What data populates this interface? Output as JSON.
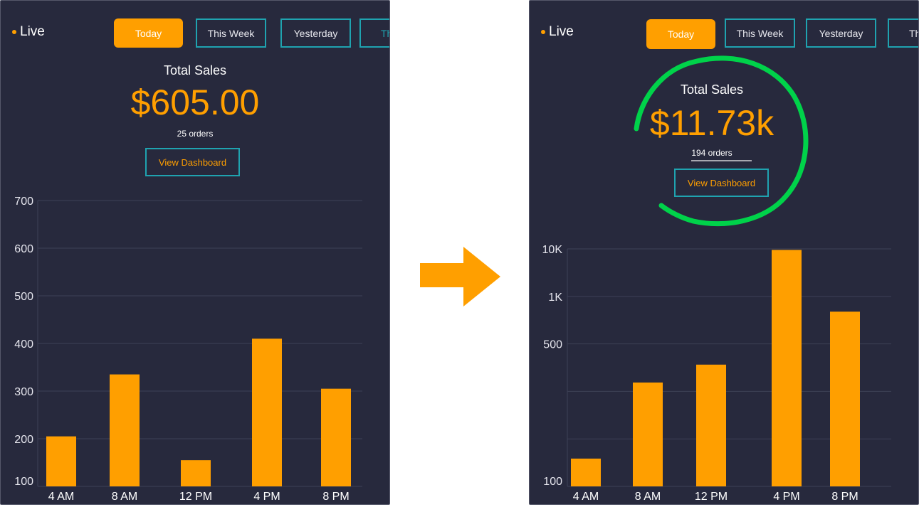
{
  "colors": {
    "panel_bg": "#27293d",
    "accent": "#ff9f00",
    "teal": "#1fa3b0",
    "grid": "#3e4156",
    "text": "#ffffff",
    "highlight_circle": "#00d24a"
  },
  "arrow_icon": "right-arrow",
  "before": {
    "live_label": "Live",
    "tabs": [
      {
        "label": "Today",
        "active": true
      },
      {
        "label": "This Week",
        "active": false
      },
      {
        "label": "Yesterday",
        "active": false
      },
      {
        "label": "Th",
        "active": false
      }
    ],
    "total_sales_label": "Total Sales",
    "total_sales_value": "$605.00",
    "orders": "25 orders",
    "view_dashboard": "View Dashboard"
  },
  "after": {
    "live_label": "Live",
    "tabs": [
      {
        "label": "Today",
        "active": true
      },
      {
        "label": "This Week",
        "active": false
      },
      {
        "label": "Yesterday",
        "active": false
      },
      {
        "label": "Th",
        "active": false
      }
    ],
    "total_sales_label": "Total Sales",
    "total_sales_value": "$11.73k",
    "orders": "194 orders",
    "view_dashboard": "View Dashboard",
    "annotation": "green hand-drawn circle around total sales"
  },
  "chart_data": [
    {
      "type": "bar",
      "title": "",
      "xlabel": "",
      "ylabel": "",
      "scale": "linear",
      "categories": [
        "4 AM",
        "8 AM",
        "12 PM",
        "4 PM",
        "8 PM"
      ],
      "values": [
        205,
        335,
        155,
        410,
        305
      ],
      "yticks": [
        100,
        200,
        300,
        400,
        500,
        600,
        700
      ],
      "ytick_labels": [
        "100",
        "200",
        "300",
        "400",
        "500",
        "600",
        "700"
      ],
      "ylim": [
        100,
        700
      ],
      "grid": true
    },
    {
      "type": "bar",
      "title": "",
      "xlabel": "",
      "ylabel": "",
      "scale": "custom-log",
      "categories": [
        "4 AM",
        "8 AM",
        "12 PM",
        "4 PM",
        "8 PM"
      ],
      "values": [
        150,
        330,
        400,
        9500,
        800
      ],
      "yticks": [
        100,
        200,
        300,
        500,
        1000,
        10000
      ],
      "ytick_labels": [
        "100",
        "",
        "",
        "500",
        "1K",
        "10K"
      ],
      "ylim": [
        100,
        10000
      ],
      "grid": true
    }
  ]
}
